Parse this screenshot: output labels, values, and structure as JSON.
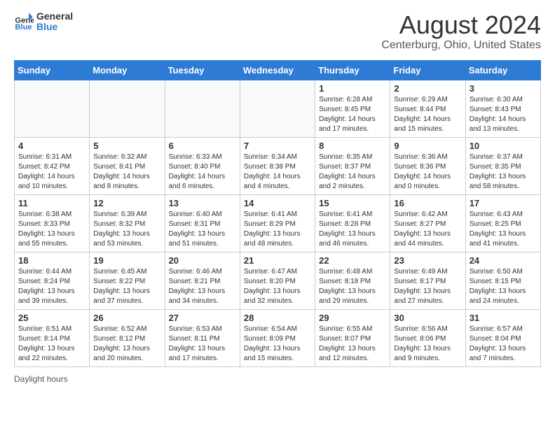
{
  "header": {
    "logo_line1": "General",
    "logo_line2": "Blue",
    "month_title": "August 2024",
    "location": "Centerburg, Ohio, United States"
  },
  "weekdays": [
    "Sunday",
    "Monday",
    "Tuesday",
    "Wednesday",
    "Thursday",
    "Friday",
    "Saturday"
  ],
  "weeks": [
    [
      {
        "day": "",
        "info": ""
      },
      {
        "day": "",
        "info": ""
      },
      {
        "day": "",
        "info": ""
      },
      {
        "day": "",
        "info": ""
      },
      {
        "day": "1",
        "info": "Sunrise: 6:28 AM\nSunset: 8:45 PM\nDaylight: 14 hours and 17 minutes."
      },
      {
        "day": "2",
        "info": "Sunrise: 6:29 AM\nSunset: 8:44 PM\nDaylight: 14 hours and 15 minutes."
      },
      {
        "day": "3",
        "info": "Sunrise: 6:30 AM\nSunset: 8:43 PM\nDaylight: 14 hours and 13 minutes."
      }
    ],
    [
      {
        "day": "4",
        "info": "Sunrise: 6:31 AM\nSunset: 8:42 PM\nDaylight: 14 hours and 10 minutes."
      },
      {
        "day": "5",
        "info": "Sunrise: 6:32 AM\nSunset: 8:41 PM\nDaylight: 14 hours and 8 minutes."
      },
      {
        "day": "6",
        "info": "Sunrise: 6:33 AM\nSunset: 8:40 PM\nDaylight: 14 hours and 6 minutes."
      },
      {
        "day": "7",
        "info": "Sunrise: 6:34 AM\nSunset: 8:38 PM\nDaylight: 14 hours and 4 minutes."
      },
      {
        "day": "8",
        "info": "Sunrise: 6:35 AM\nSunset: 8:37 PM\nDaylight: 14 hours and 2 minutes."
      },
      {
        "day": "9",
        "info": "Sunrise: 6:36 AM\nSunset: 8:36 PM\nDaylight: 14 hours and 0 minutes."
      },
      {
        "day": "10",
        "info": "Sunrise: 6:37 AM\nSunset: 8:35 PM\nDaylight: 13 hours and 58 minutes."
      }
    ],
    [
      {
        "day": "11",
        "info": "Sunrise: 6:38 AM\nSunset: 8:33 PM\nDaylight: 13 hours and 55 minutes."
      },
      {
        "day": "12",
        "info": "Sunrise: 6:39 AM\nSunset: 8:32 PM\nDaylight: 13 hours and 53 minutes."
      },
      {
        "day": "13",
        "info": "Sunrise: 6:40 AM\nSunset: 8:31 PM\nDaylight: 13 hours and 51 minutes."
      },
      {
        "day": "14",
        "info": "Sunrise: 6:41 AM\nSunset: 8:29 PM\nDaylight: 13 hours and 48 minutes."
      },
      {
        "day": "15",
        "info": "Sunrise: 6:41 AM\nSunset: 8:28 PM\nDaylight: 13 hours and 46 minutes."
      },
      {
        "day": "16",
        "info": "Sunrise: 6:42 AM\nSunset: 8:27 PM\nDaylight: 13 hours and 44 minutes."
      },
      {
        "day": "17",
        "info": "Sunrise: 6:43 AM\nSunset: 8:25 PM\nDaylight: 13 hours and 41 minutes."
      }
    ],
    [
      {
        "day": "18",
        "info": "Sunrise: 6:44 AM\nSunset: 8:24 PM\nDaylight: 13 hours and 39 minutes."
      },
      {
        "day": "19",
        "info": "Sunrise: 6:45 AM\nSunset: 8:22 PM\nDaylight: 13 hours and 37 minutes."
      },
      {
        "day": "20",
        "info": "Sunrise: 6:46 AM\nSunset: 8:21 PM\nDaylight: 13 hours and 34 minutes."
      },
      {
        "day": "21",
        "info": "Sunrise: 6:47 AM\nSunset: 8:20 PM\nDaylight: 13 hours and 32 minutes."
      },
      {
        "day": "22",
        "info": "Sunrise: 6:48 AM\nSunset: 8:18 PM\nDaylight: 13 hours and 29 minutes."
      },
      {
        "day": "23",
        "info": "Sunrise: 6:49 AM\nSunset: 8:17 PM\nDaylight: 13 hours and 27 minutes."
      },
      {
        "day": "24",
        "info": "Sunrise: 6:50 AM\nSunset: 8:15 PM\nDaylight: 13 hours and 24 minutes."
      }
    ],
    [
      {
        "day": "25",
        "info": "Sunrise: 6:51 AM\nSunset: 8:14 PM\nDaylight: 13 hours and 22 minutes."
      },
      {
        "day": "26",
        "info": "Sunrise: 6:52 AM\nSunset: 8:12 PM\nDaylight: 13 hours and 20 minutes."
      },
      {
        "day": "27",
        "info": "Sunrise: 6:53 AM\nSunset: 8:11 PM\nDaylight: 13 hours and 17 minutes."
      },
      {
        "day": "28",
        "info": "Sunrise: 6:54 AM\nSunset: 8:09 PM\nDaylight: 13 hours and 15 minutes."
      },
      {
        "day": "29",
        "info": "Sunrise: 6:55 AM\nSunset: 8:07 PM\nDaylight: 13 hours and 12 minutes."
      },
      {
        "day": "30",
        "info": "Sunrise: 6:56 AM\nSunset: 8:06 PM\nDaylight: 13 hours and 9 minutes."
      },
      {
        "day": "31",
        "info": "Sunrise: 6:57 AM\nSunset: 8:04 PM\nDaylight: 13 hours and 7 minutes."
      }
    ]
  ],
  "footer": {
    "daylight_label": "Daylight hours"
  }
}
